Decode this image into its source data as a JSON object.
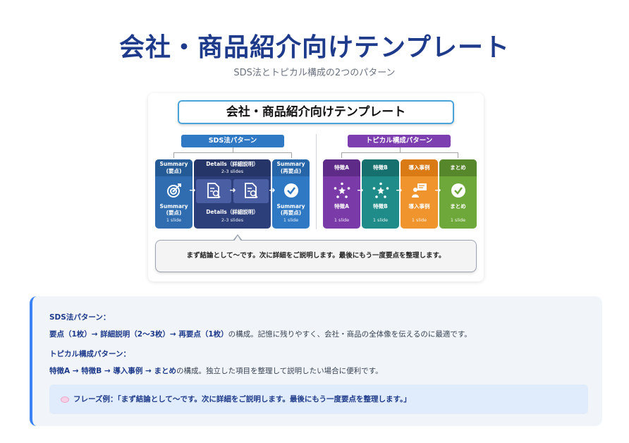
{
  "header": {
    "title": "会社・商品紹介向けテンプレート",
    "subtitle": "SDS法とトピカル構成の2つのパターン"
  },
  "diagram": {
    "title": "会社・商品紹介向けテンプレート",
    "sds_label": "SDS法パターン",
    "topical_label": "トピカル構成パターン",
    "sds_steps": [
      {
        "head": "Summary\n(要点)",
        "name": "Summary\n(要点)",
        "sub": "1 slide",
        "icon": "target-icon"
      },
      {
        "head": "Details（詳細説明）",
        "head_sub": "2-3 slides",
        "name": "Details（詳細説明）",
        "sub": "2-3 slides",
        "icon": "document-search-icon"
      },
      {
        "head": "Summary\n(再要点)",
        "name": "Summary\n(再要点)",
        "sub": "1 slide",
        "icon": "check-circle-icon"
      }
    ],
    "topical_steps": [
      {
        "head": "特徴A",
        "name": "特徴A",
        "sub": "1 slide",
        "icon": "network-star-icon",
        "color": "#7a3aa8"
      },
      {
        "head": "特徴B",
        "name": "特徴B",
        "sub": "1 slide",
        "icon": "network-star-icon",
        "color": "#1f8c8a"
      },
      {
        "head": "導入事例",
        "name": "導入事例",
        "sub": "1 slide",
        "icon": "presenter-icon",
        "color": "#f0942d"
      },
      {
        "head": "まとめ",
        "name": "まとめ",
        "sub": "1 slide",
        "icon": "check-circle-icon",
        "color": "#6fa83a"
      }
    ],
    "speech": "まず結論として〜です。次に詳細をご説明します。最後にもう一度要点を整理します。"
  },
  "info": {
    "sds_heading": "SDS法パターン：",
    "sds_flow": "要点（1枚）→ 詳細説明（2〜3枚）→ 再要点（1枚）",
    "sds_desc": "の構成。記憶に残りやすく、会社・商品の全体像を伝えるのに最適です。",
    "topical_heading": "トピカル構成パターン：",
    "topical_flow": "特徴A → 特徴B → 導入事例 → まとめ",
    "topical_desc": "の構成。独立した項目を整理して説明したい場合に便利です。",
    "phrase_label": "フレーズ例：",
    "phrase_text": "「まず結論として〜です。次に詳細をご説明します。最後にもう一度要点を整理します。」"
  }
}
